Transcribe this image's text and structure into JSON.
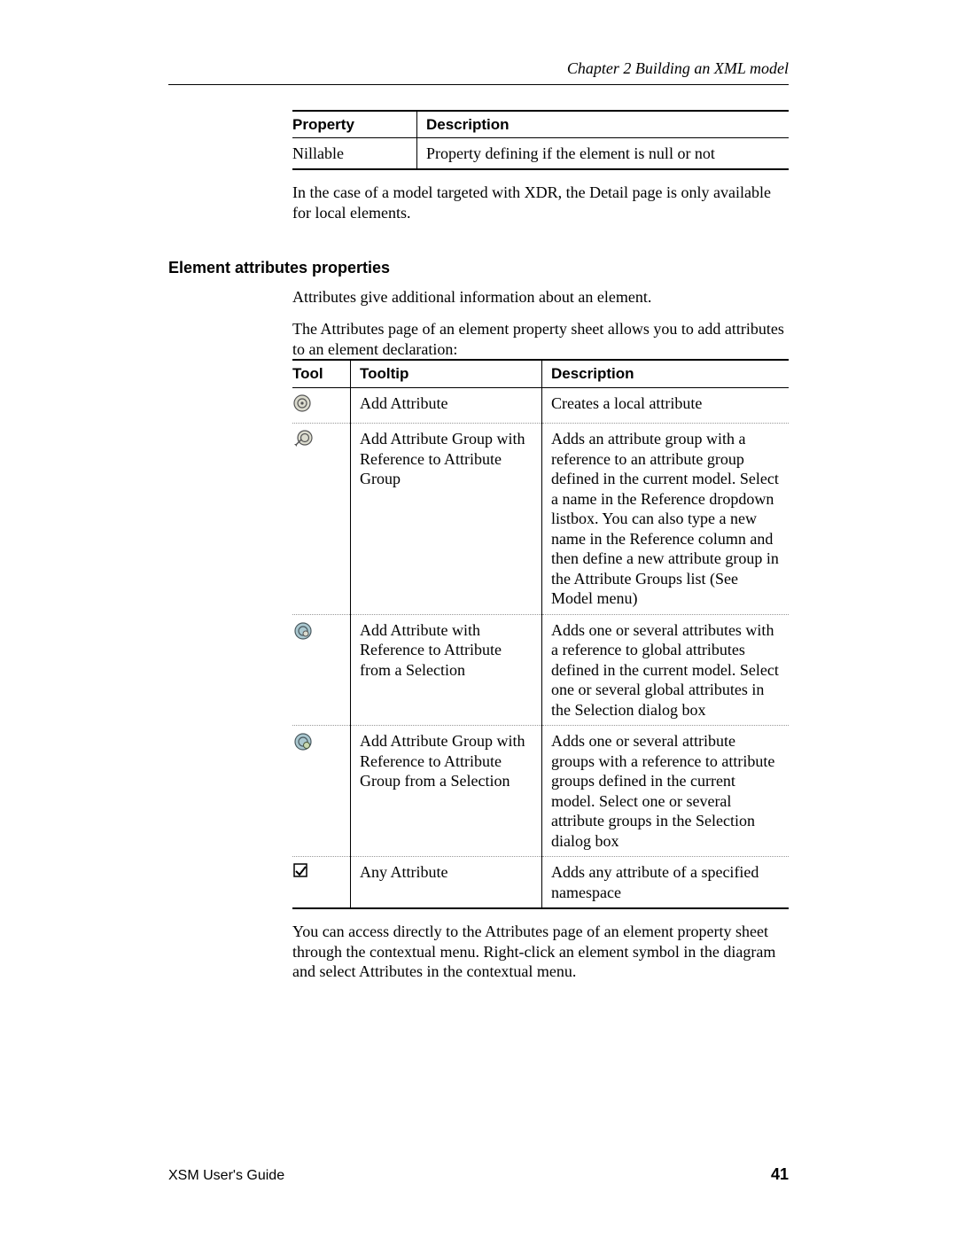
{
  "header": {
    "running_title": "Chapter 2  Building an XML model"
  },
  "prop_table": {
    "headers": {
      "c1": "Property",
      "c2": "Description"
    },
    "row": {
      "property": "Nillable",
      "description": "Property defining if the element is null or not"
    }
  },
  "para_xdr": "In the case of a model targeted with XDR, the Detail page is only available for local elements.",
  "section_heading": "Element attributes properties",
  "para_intro": "Attributes give additional information about an element.",
  "para_attr_page": "The Attributes page of an element property sheet allows you to add attributes to an element declaration:",
  "tool_table": {
    "headers": {
      "c1": "Tool",
      "c2": "Tooltip",
      "c3": "Description"
    },
    "rows": [
      {
        "tooltip": "Add Attribute",
        "description": "Creates a local attribute"
      },
      {
        "tooltip": "Add Attribute Group with Reference to Attribute Group",
        "description": "Adds an attribute group with a reference to an attribute group defined in the current model. Select a name in the Reference dropdown listbox. You can also type a new name in the Reference column and then define a new attribute group in the Attribute Groups list (See Model menu)"
      },
      {
        "tooltip": "Add Attribute with Reference to Attribute from a Selection",
        "description": "Adds one or several attributes with a reference to global attributes defined in the current model. Select one or several global attributes in the Selection dialog box"
      },
      {
        "tooltip": "Add Attribute Group with Reference to Attribute Group from a Selection",
        "description": "Adds one or several attribute groups with a reference to attribute groups defined in the current model. Select one or several attribute groups in the Selection dialog box"
      },
      {
        "tooltip": "Any Attribute",
        "description": "Adds any attribute of a specified namespace"
      }
    ]
  },
  "para_access": "You can access directly to the Attributes page of an element property sheet through the contextual menu. Right-click an element symbol in the diagram and select Attributes in the contextual menu.",
  "footer": {
    "guide": "XSM User's Guide",
    "page_number": "41"
  }
}
